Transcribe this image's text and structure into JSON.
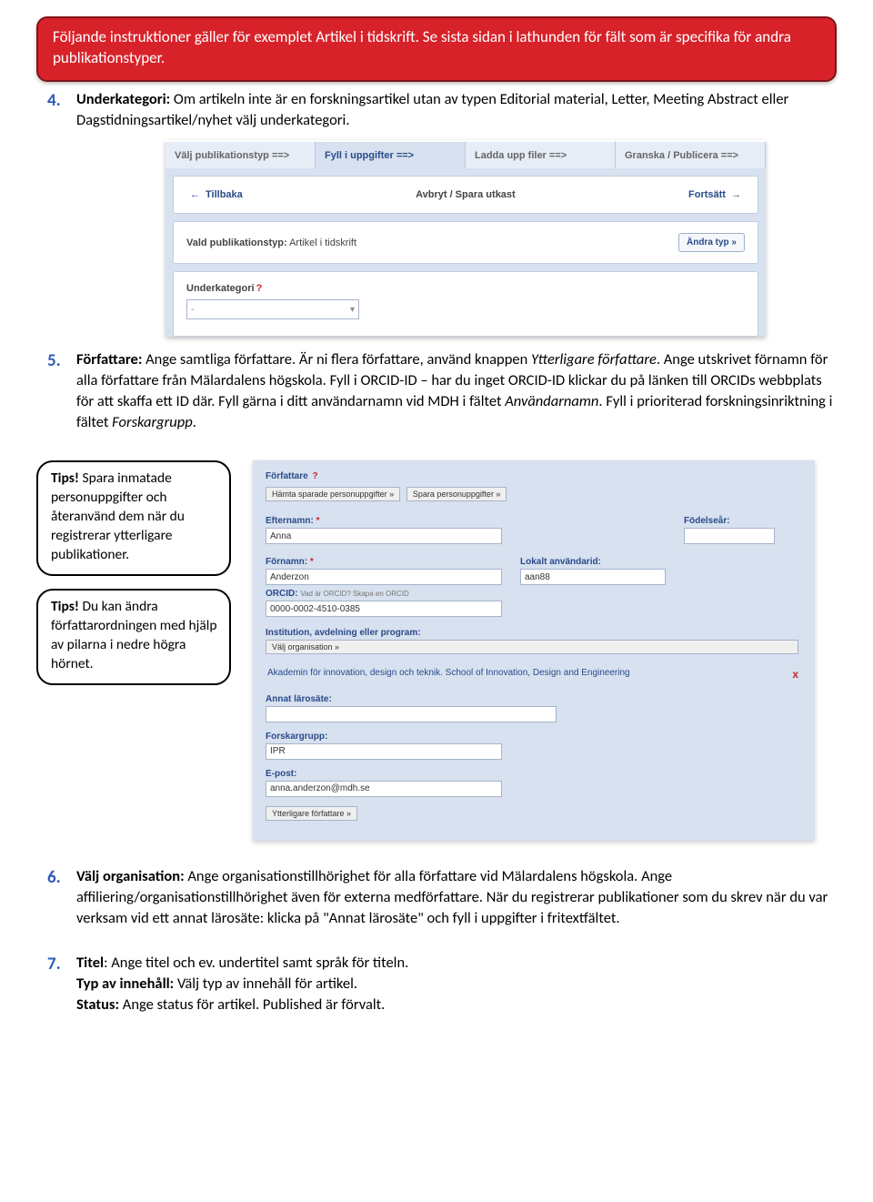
{
  "banner": "Följande instruktioner gäller för exemplet Artikel i tidskrift. Se sista sidan i lathunden för fält som är specifika för andra publikationstyper.",
  "steps": {
    "s4": {
      "num": "4.",
      "label": "Underkategori:",
      "text": " Om artikeln inte är en forskningsartikel utan av typen Editorial material, Letter, Meeting Abstract eller Dagstidningsartikel/nyhet välj underkategori."
    },
    "s5": {
      "num": "5.",
      "label": "Författare:",
      "t1": " Ange samtliga författare. Är ni flera författare, använd knappen ",
      "i1": "Ytterligare författare",
      "t2": ". Ange utskrivet förnamn för alla författare från Mälardalens högskola. Fyll i ORCID-ID – har du inget ORCID-ID klickar du på länken till ORCIDs webbplats för att skaffa ett ID där. Fyll gärna i ditt användarnamn vid MDH i fältet ",
      "i2": "Användarnamn",
      "t3": ". Fyll i prioriterad forskningsinriktning i fältet ",
      "i3": "Forskargrupp",
      "t4": "."
    },
    "s6": {
      "num": "6.",
      "label": "Välj organisation:",
      "text": " Ange organisationstillhörighet för alla författare vid Mälardalens högskola. Ange affiliering/organisationstillhörighet även för externa medförfattare. När du registrerar publikationer som du skrev när du var verksam vid ett annat lärosäte: klicka på \"Annat lärosäte\" och fyll i uppgifter i fritextfältet."
    },
    "s7": {
      "num": "7.",
      "l1": "Titel",
      "t1": ": Ange titel och ev. undertitel samt språk för titeln.",
      "l2": "Typ av innehåll:",
      "t2": " Välj typ av innehåll för artikel.",
      "l3": "Status:",
      "t3": " Ange status för artikel. Published är förvalt."
    }
  },
  "panel1": {
    "tabs": [
      "Välj publikationstyp ==>",
      "Fyll i uppgifter ==>",
      "Ladda upp filer ==>",
      "Granska / Publicera ==>"
    ],
    "back": "Tillbaka",
    "center": "Avbryt / Spara utkast",
    "fwd": "Fortsätt",
    "vald_l": "Vald publikationstyp:",
    "vald_v": " Artikel i tidskrift",
    "change": "Ändra typ »",
    "underkat": "Underkategori",
    "select": "-"
  },
  "tips": {
    "t1_l": "Tips!",
    "t1_t": " Spara inmatade personuppgifter och återanvänd dem när du registrerar ytterligare publikationer.",
    "t2_l": "Tips!",
    "t2_t": " Du kan ändra författarordningen med hjälp av pilarna i nedre högra hörnet."
  },
  "panel2": {
    "header": "Författare",
    "btn_hamta": "Hämta sparade personuppgifter »",
    "btn_spara": "Spara personuppgifter »",
    "efternamn_l": "Efternamn:",
    "efternamn_v": "Anna",
    "fodelsear_l": "Födelseår:",
    "fornamn_l": "Förnamn:",
    "fornamn_v": "Anderzon",
    "lokal_l": "Lokalt användarid:",
    "lokal_v": "aan88",
    "orcid_l": "ORCID:",
    "orcid_hint": "Vad är ORCID? Skapa en ORCID",
    "orcid_v": "0000-0002-4510-0385",
    "inst_l": "Institution, avdelning eller program:",
    "valj_org": "Välj organisation »",
    "org_text": "Akademin för innovation, design och teknik. School of Innovation, Design and Engineering",
    "annat_l": "Annat lärosäte:",
    "forsk_l": "Forskargrupp:",
    "forsk_v": "IPR",
    "epost_l": "E-post:",
    "epost_v": "anna.anderzon@mdh.se",
    "btn_ytter": "Ytterligare författare »"
  }
}
